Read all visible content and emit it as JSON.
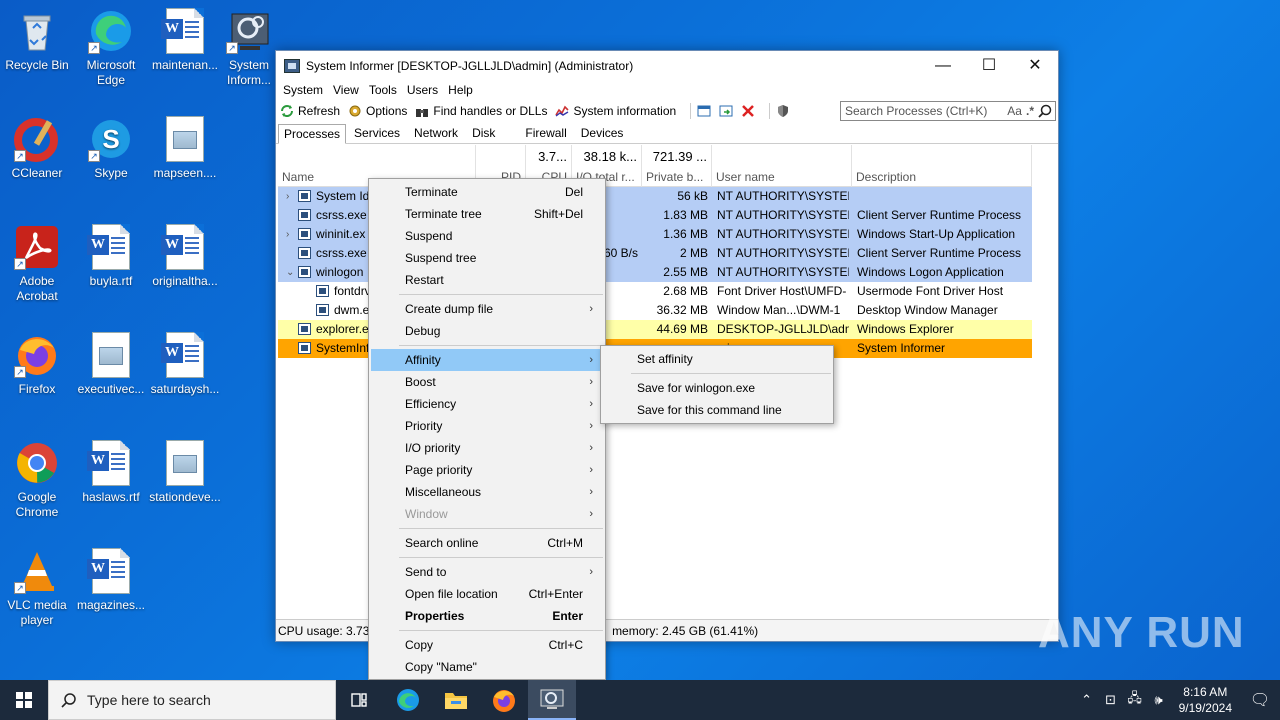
{
  "desktop": {
    "icons": [
      {
        "label": "Recycle Bin"
      },
      {
        "label": "Microsoft Edge"
      },
      {
        "label": "maintenan..."
      },
      {
        "label": "System Inform..."
      },
      {
        "label": "CCleaner"
      },
      {
        "label": "Skype"
      },
      {
        "label": "mapseen...."
      },
      {
        "label": "Adobe Acrobat"
      },
      {
        "label": "buyla.rtf"
      },
      {
        "label": "originaltha..."
      },
      {
        "label": "Firefox"
      },
      {
        "label": "executivec..."
      },
      {
        "label": "saturdaysh..."
      },
      {
        "label": "Google Chrome"
      },
      {
        "label": "haslaws.rtf"
      },
      {
        "label": "stationdeve..."
      },
      {
        "label": "VLC media player"
      },
      {
        "label": "magazines..."
      }
    ]
  },
  "window": {
    "title": "System Informer [DESKTOP-JGLLJLD\\admin] (Administrator)",
    "minimize": "—",
    "maximize": "☐",
    "close": "✕"
  },
  "menubar": [
    "System",
    "View",
    "Tools",
    "Users",
    "Help"
  ],
  "toolbar": {
    "refresh": "Refresh",
    "options": "Options",
    "find_handles": "Find handles or DLLs",
    "system_information": "System information",
    "search_placeholder": "Search Processes (Ctrl+K)",
    "search_aa": "Aa",
    "search_regex": ".*"
  },
  "tabs": [
    "Processes",
    "Services",
    "Network",
    "Disk",
    "Firewall",
    "Devices"
  ],
  "columns": {
    "name": "Name",
    "pid": "PID",
    "cpu": "CPU",
    "cpu_total": "3.7...",
    "io": "I/O total r...",
    "io_total": "38.18 k...",
    "private": "Private b...",
    "private_total": "721.39 ...",
    "user": "User name",
    "description": "Description"
  },
  "processes": [
    {
      "name": "System Id",
      "io": "",
      "private": "56 kB",
      "user": "NT AUTHORITY\\SYSTEM",
      "desc": "",
      "exp": "›"
    },
    {
      "name": "csrss.exe",
      "io": "",
      "private": "1.83 MB",
      "user": "NT AUTHORITY\\SYSTEM",
      "desc": "Client Server Runtime Process",
      "exp": ""
    },
    {
      "name": "wininit.ex",
      "io": "",
      "private": "1.36 MB",
      "user": "NT AUTHORITY\\SYSTEM",
      "desc": "Windows Start-Up Application",
      "exp": "›"
    },
    {
      "name": "csrss.exe",
      "io": "60 B/s",
      "private": "2 MB",
      "user": "NT AUTHORITY\\SYSTEM",
      "desc": "Client Server Runtime Process",
      "exp": ""
    },
    {
      "name": "winlogon",
      "io": "",
      "private": "2.55 MB",
      "user": "NT AUTHORITY\\SYSTEM",
      "desc": "Windows Logon Application",
      "exp": "⌄"
    },
    {
      "name": "fontdrv",
      "io": "",
      "private": "2.68 MB",
      "user": "Font Driver Host\\UMFD-",
      "desc": "Usermode Font Driver Host",
      "exp": ""
    },
    {
      "name": "dwm.e",
      "io": "",
      "private": "36.32 MB",
      "user": "Window Man...\\DWM-1",
      "desc": "Desktop Window Manager",
      "exp": ""
    },
    {
      "name": "explorer.e",
      "io": "",
      "private": "44.69 MB",
      "user": "DESKTOP-JGLLJLD\\admi",
      "desc": "Windows Explorer",
      "exp": ""
    },
    {
      "name": "SystemInf",
      "io": "",
      "private": "",
      "user": "mi",
      "desc": "System Informer",
      "exp": ""
    }
  ],
  "status": {
    "cpu": "CPU usage: 3.73%",
    "memory": "memory: 2.45 GB (61.41%)"
  },
  "context_menu": {
    "items": [
      {
        "label": "Terminate",
        "shortcut": "Del"
      },
      {
        "label": "Terminate tree",
        "shortcut": "Shift+Del"
      },
      {
        "label": "Suspend",
        "shortcut": ""
      },
      {
        "label": "Suspend tree",
        "shortcut": ""
      },
      {
        "label": "Restart",
        "shortcut": ""
      },
      {
        "label": "Create dump file",
        "shortcut": ""
      },
      {
        "label": "Debug",
        "shortcut": ""
      },
      {
        "label": "Affinity",
        "shortcut": ""
      },
      {
        "label": "Boost",
        "shortcut": ""
      },
      {
        "label": "Efficiency",
        "shortcut": ""
      },
      {
        "label": "Priority",
        "shortcut": ""
      },
      {
        "label": "I/O priority",
        "shortcut": ""
      },
      {
        "label": "Page priority",
        "shortcut": ""
      },
      {
        "label": "Miscellaneous",
        "shortcut": ""
      },
      {
        "label": "Window",
        "shortcut": ""
      },
      {
        "label": "Search online",
        "shortcut": "Ctrl+M"
      },
      {
        "label": "Send to",
        "shortcut": ""
      },
      {
        "label": "Open file location",
        "shortcut": "Ctrl+Enter"
      },
      {
        "label": "Properties",
        "shortcut": "Enter"
      },
      {
        "label": "Copy",
        "shortcut": "Ctrl+C"
      },
      {
        "label": "Copy \"Name\"",
        "shortcut": ""
      }
    ]
  },
  "affinity_submenu": {
    "set_affinity": "Set affinity",
    "save_for_exe": "Save for winlogon.exe",
    "save_for_cmd": "Save for this command line"
  },
  "taskbar": {
    "search_placeholder": "Type here to search",
    "time": "8:16 AM",
    "date": "9/19/2024"
  },
  "watermark": "ANY RUN"
}
